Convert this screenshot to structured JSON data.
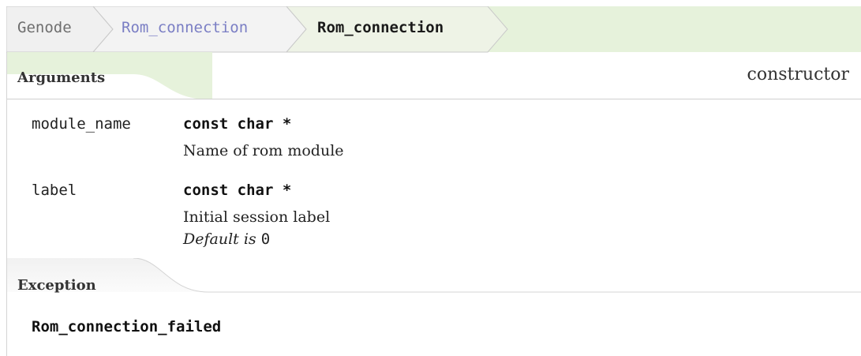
{
  "breadcrumb": {
    "items": [
      {
        "label": "Genode"
      },
      {
        "label": "Rom_connection"
      },
      {
        "label": "Rom_connection"
      }
    ]
  },
  "kind": "constructor",
  "arguments": {
    "title": "Arguments",
    "items": [
      {
        "name": "module_name",
        "type": "const char *",
        "description": "Name of rom module",
        "default_prefix": "",
        "default_value": ""
      },
      {
        "name": "label",
        "type": "const char *",
        "description": "Initial session label",
        "default_prefix": "Default is ",
        "default_value": "0"
      }
    ]
  },
  "exception": {
    "title": "Exception",
    "name": "Rom_connection_failed"
  },
  "colors": {
    "header_band": "#e6f2db",
    "crumb_fill": "#f0f0f0",
    "crumb_active_fill": "#eef3e6",
    "link": "#7a7ec4"
  }
}
